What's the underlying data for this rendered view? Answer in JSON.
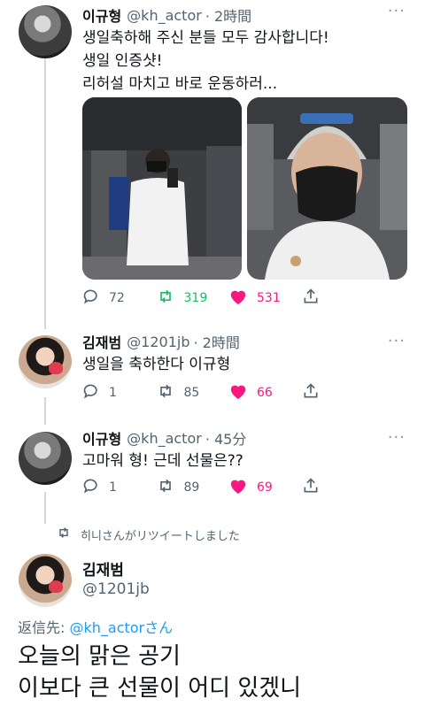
{
  "tweets": [
    {
      "name": "이규형",
      "handle": "@kh_actor",
      "time": "· 2時間",
      "text": "생일축하해 주신 분들 모두 감사합니다!\n생일 인증샷!\n리허설 마치고 바로 운동하러...",
      "replies": "72",
      "retweets": "319",
      "likes": "531"
    },
    {
      "name": "김재범",
      "handle": "@1201jb",
      "time": "· 2時間",
      "text": "생일을 축하한다 이규형",
      "replies": "1",
      "retweets": "85",
      "likes": "66"
    },
    {
      "name": "이규형",
      "handle": "@kh_actor",
      "time": "· 45分",
      "text": "고마워 형! 근데 선물은??",
      "replies": "1",
      "retweets": "89",
      "likes": "69"
    }
  ],
  "retweet_note": "히니さんがリツイートしました",
  "main_tweet": {
    "name": "김재범",
    "handle": "@1201jb",
    "reply_prefix": "返信先:",
    "reply_mention": "@kh_actor",
    "reply_suffix": "さん",
    "text": "오늘의 맑은 공기\n이보다 큰 선물이 어디 있겠니"
  },
  "icons": {
    "reply": "reply-icon",
    "retweet": "retweet-icon",
    "like": "heart-icon",
    "share": "share-icon",
    "more": "more-icon"
  },
  "colors": {
    "retweet_active": "#17bf63",
    "like_active": "#f91880",
    "link": "#1d9bf0",
    "secondary_text": "#536471"
  }
}
